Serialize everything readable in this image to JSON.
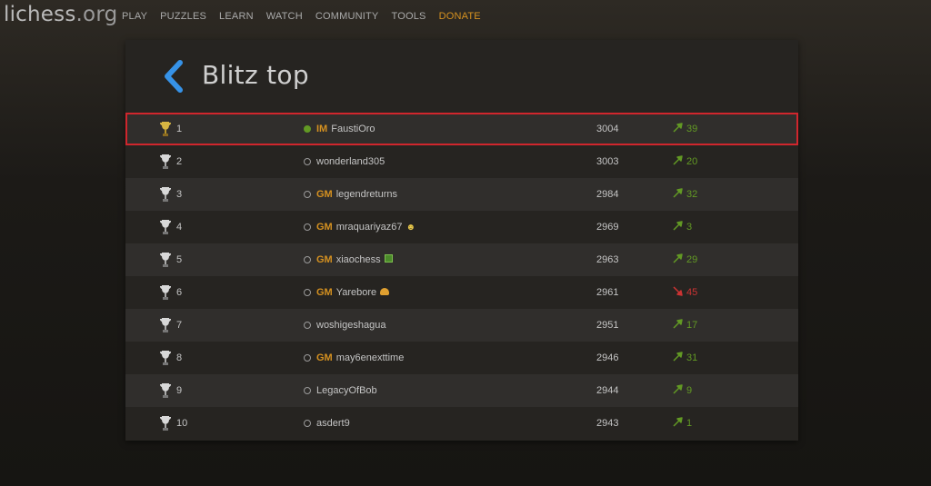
{
  "header": {
    "logo_main": "lichess",
    "logo_tld": ".org",
    "nav": [
      {
        "label": "PLAY"
      },
      {
        "label": "PUZZLES"
      },
      {
        "label": "LEARN"
      },
      {
        "label": "WATCH"
      },
      {
        "label": "COMMUNITY"
      },
      {
        "label": "TOOLS"
      },
      {
        "label": "DONATE"
      }
    ]
  },
  "page": {
    "title": "Blitz top",
    "back_icon": "chevron-left-icon"
  },
  "colors": {
    "accent_title": "#d59120",
    "online": "#629924",
    "progress_up": "#629924",
    "progress_down": "#cc3333",
    "highlight_border": "#d0262d",
    "back_arrow": "#3692e7"
  },
  "leaderboard": [
    {
      "rank": "1",
      "online": true,
      "title": "IM",
      "name": "FaustiOro",
      "flair": "",
      "rating": "3004",
      "progress": "39",
      "direction": "up",
      "highlight": true
    },
    {
      "rank": "2",
      "online": false,
      "title": "",
      "name": "wonderland305",
      "flair": "",
      "rating": "3003",
      "progress": "20",
      "direction": "up",
      "highlight": false
    },
    {
      "rank": "3",
      "online": false,
      "title": "GM",
      "name": "legendreturns",
      "flair": "",
      "rating": "2984",
      "progress": "32",
      "direction": "up",
      "highlight": false
    },
    {
      "rank": "4",
      "online": false,
      "title": "GM",
      "name": "mraquariyaz67",
      "flair": "face-icon",
      "rating": "2969",
      "progress": "3",
      "direction": "up",
      "highlight": false
    },
    {
      "rank": "5",
      "online": false,
      "title": "GM",
      "name": "xiaochess",
      "flair": "flag-icon",
      "rating": "2963",
      "progress": "29",
      "direction": "up",
      "highlight": false
    },
    {
      "rank": "6",
      "online": false,
      "title": "GM",
      "name": "Yarebore",
      "flair": "burger-icon",
      "rating": "2961",
      "progress": "45",
      "direction": "down",
      "highlight": false
    },
    {
      "rank": "7",
      "online": false,
      "title": "",
      "name": "woshigeshagua",
      "flair": "",
      "rating": "2951",
      "progress": "17",
      "direction": "up",
      "highlight": false
    },
    {
      "rank": "8",
      "online": false,
      "title": "GM",
      "name": "may6enexttime",
      "flair": "",
      "rating": "2946",
      "progress": "31",
      "direction": "up",
      "highlight": false
    },
    {
      "rank": "9",
      "online": false,
      "title": "",
      "name": "LegacyOfBob",
      "flair": "",
      "rating": "2944",
      "progress": "9",
      "direction": "up",
      "highlight": false
    },
    {
      "rank": "10",
      "online": false,
      "title": "",
      "name": "asdert9",
      "flair": "",
      "rating": "2943",
      "progress": "1",
      "direction": "up",
      "highlight": false
    }
  ]
}
